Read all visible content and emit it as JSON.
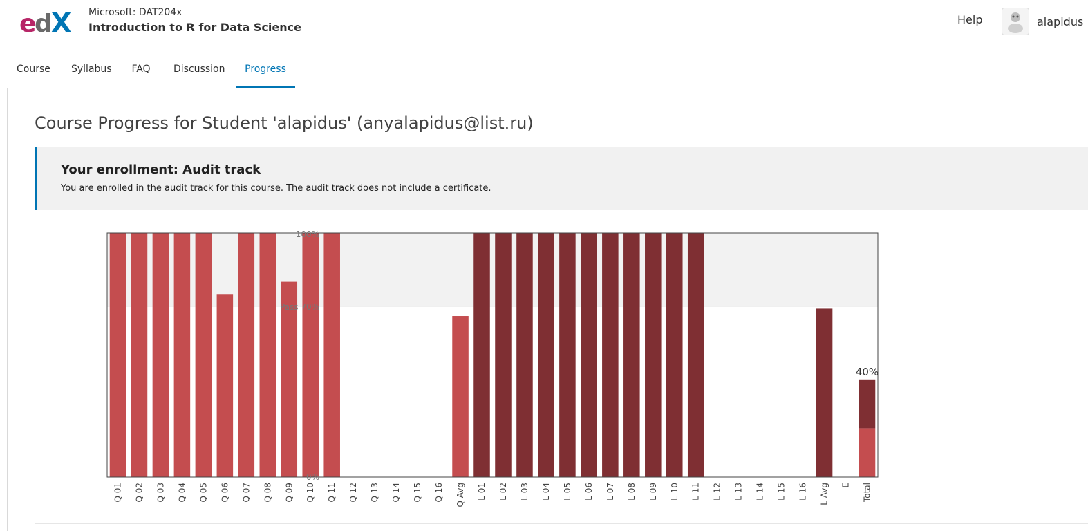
{
  "header": {
    "course_org": "Microsoft: DAT204x",
    "course_title": "Introduction to R for Data Science",
    "help_label": "Help",
    "username": "alapidus",
    "logo_icon": "edx-logo-icon",
    "avatar_icon": "user-avatar-icon"
  },
  "tabs": [
    {
      "label": "Course"
    },
    {
      "label": "Syllabus"
    },
    {
      "label": "FAQ"
    },
    {
      "label": "Discussion"
    },
    {
      "label": "Progress",
      "active": true
    }
  ],
  "page_title": "Course Progress for Student 'alapidus' (anyalapidus@list.ru)",
  "enrollment": {
    "title": "Your enrollment: Audit track",
    "text": "You are enrolled in the audit track for this course. The audit track does not include a certificate."
  },
  "colors": {
    "accent": "#0075b4",
    "quiz_bar": "#c44d4f",
    "lab_bar": "#7f2f33",
    "pass_band": "#f2f2f2"
  },
  "chart_data": {
    "type": "bar",
    "ylim": [
      0,
      100
    ],
    "y_labels": [
      "100%",
      "Pass 70%",
      "0%"
    ],
    "pass_threshold": 70,
    "categories": [
      "Q 01",
      "Q 02",
      "Q 03",
      "Q 04",
      "Q 05",
      "Q 06",
      "Q 07",
      "Q 08",
      "Q 09",
      "Q 10",
      "Q 11",
      "Q 12",
      "Q 13",
      "Q 14",
      "Q 15",
      "Q 16",
      "Q Avg",
      "L 01",
      "L 02",
      "L 03",
      "L 04",
      "L 05",
      "L 06",
      "L 07",
      "L 08",
      "L 09",
      "L 10",
      "L 11",
      "L 12",
      "L 13",
      "L 14",
      "L 15",
      "L 16",
      "L Avg",
      "E",
      "Total"
    ],
    "values": [
      100,
      100,
      100,
      100,
      100,
      75,
      100,
      100,
      80,
      100,
      100,
      0,
      0,
      0,
      0,
      0,
      66,
      100,
      100,
      100,
      100,
      100,
      100,
      100,
      100,
      100,
      100,
      100,
      0,
      0,
      0,
      0,
      0,
      69,
      0,
      40
    ],
    "series_types": [
      "q",
      "q",
      "q",
      "q",
      "q",
      "q",
      "q",
      "q",
      "q",
      "q",
      "q",
      "q",
      "q",
      "q",
      "q",
      "q",
      "q",
      "l",
      "l",
      "l",
      "l",
      "l",
      "l",
      "l",
      "l",
      "l",
      "l",
      "l",
      "l",
      "l",
      "l",
      "l",
      "l",
      "l",
      "e",
      "total"
    ],
    "total": {
      "label": "40%",
      "quiz_part": 20,
      "lab_part": 20
    }
  }
}
